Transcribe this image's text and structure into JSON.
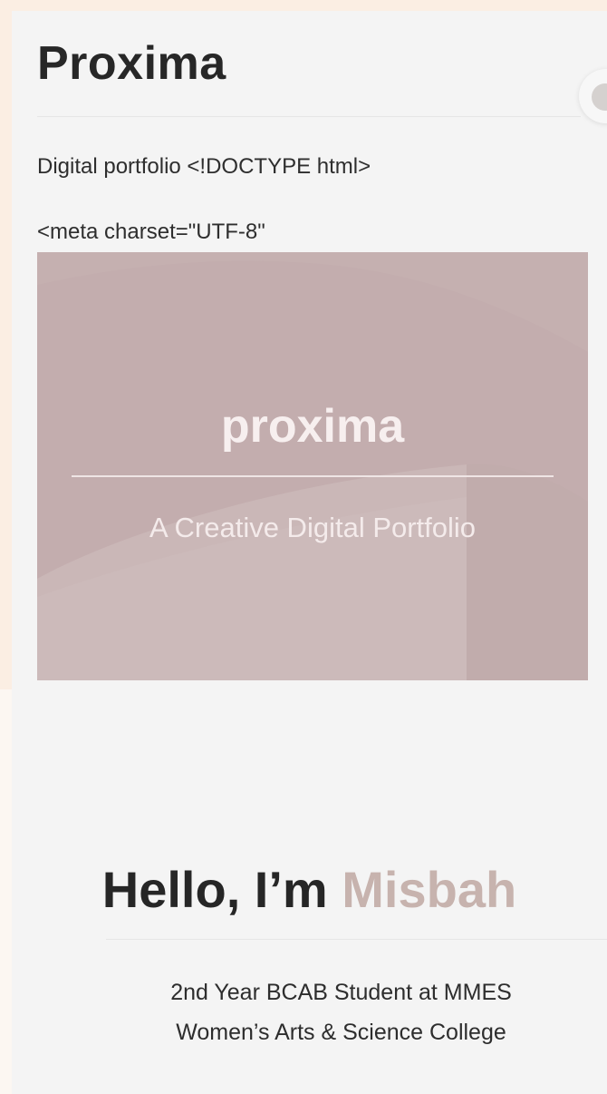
{
  "header": {
    "title": "Proxima"
  },
  "intro": {
    "line1": "Digital portfolio <!DOCTYPE html>",
    "line2": "<meta charset=\"UTF-8\""
  },
  "hero": {
    "title": "proxima",
    "subtitle": "A Creative Digital Portfolio"
  },
  "greeting": {
    "prefix": "Hello, I’m ",
    "name": "Misbah"
  },
  "bio": {
    "line1": "2nd Year BCAB Student at MMES",
    "line2": "Women’s Arts & Science College"
  },
  "colors": {
    "hero_background": "#c3adae",
    "accent_name": "#c7b3ae",
    "card_background": "#f4f4f4"
  }
}
